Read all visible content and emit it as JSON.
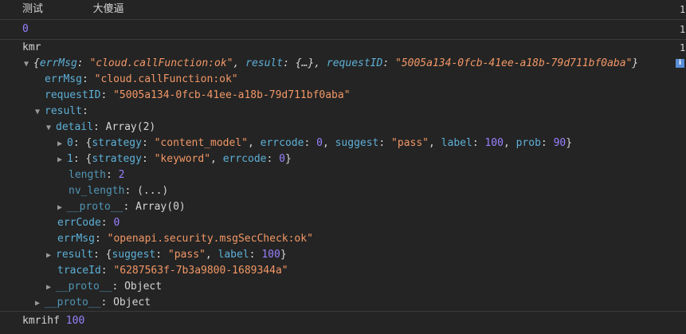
{
  "log1": {
    "label": "测试",
    "value": "大傻逼"
  },
  "log2": {
    "value": "0"
  },
  "log3": {
    "label": "kmr",
    "summary": {
      "errMsg_key": "errMsg",
      "errMsg_val": "\"cloud.callFunction:ok\"",
      "result_key": "result",
      "result_val": "{…}",
      "requestID_key": "requestID",
      "requestID_val": "\"5005a134-0fcb-41ee-a18b-79d711bf0aba\""
    },
    "errMsg": {
      "key": "errMsg",
      "val": "\"cloud.callFunction:ok\""
    },
    "requestID": {
      "key": "requestID",
      "val": "\"5005a134-0fcb-41ee-a18b-79d711bf0aba\""
    },
    "result": {
      "key": "result",
      "detail": {
        "key": "detail",
        "type": "Array(2)",
        "item0": {
          "idx": "0",
          "strategy_key": "strategy",
          "strategy_val": "\"content_model\"",
          "errcode_key": "errcode",
          "errcode_val": "0",
          "suggest_key": "suggest",
          "suggest_val": "\"pass\"",
          "label_key": "label",
          "label_val": "100",
          "prob_key": "prob",
          "prob_val": "90"
        },
        "item1": {
          "idx": "1",
          "strategy_key": "strategy",
          "strategy_val": "\"keyword\"",
          "errcode_key": "errcode",
          "errcode_val": "0"
        },
        "length_key": "length",
        "length_val": "2",
        "nvlength_key": "nv_length",
        "nvlength_val": "(...)",
        "proto_key": "__proto__",
        "proto_val": "Array(0)"
      },
      "errCode": {
        "key": "errCode",
        "val": "0"
      },
      "errMsg": {
        "key": "errMsg",
        "val": "\"openapi.security.msgSecCheck:ok\""
      },
      "inner_result": {
        "key": "result",
        "suggest_key": "suggest",
        "suggest_val": "\"pass\"",
        "label_key": "label",
        "label_val": "100"
      },
      "traceId": {
        "key": "traceId",
        "val": "\"6287563f-7b3a9800-1689344a\""
      },
      "proto": {
        "key": "__proto__",
        "val": "Object"
      }
    },
    "proto": {
      "key": "__proto__",
      "val": "Object"
    }
  },
  "log4": {
    "label": "kmrihf",
    "value": "100"
  },
  "colors": {
    "number": "#9980ff",
    "string": "#f29766",
    "key": "#5db0d7",
    "background": "#242424"
  }
}
